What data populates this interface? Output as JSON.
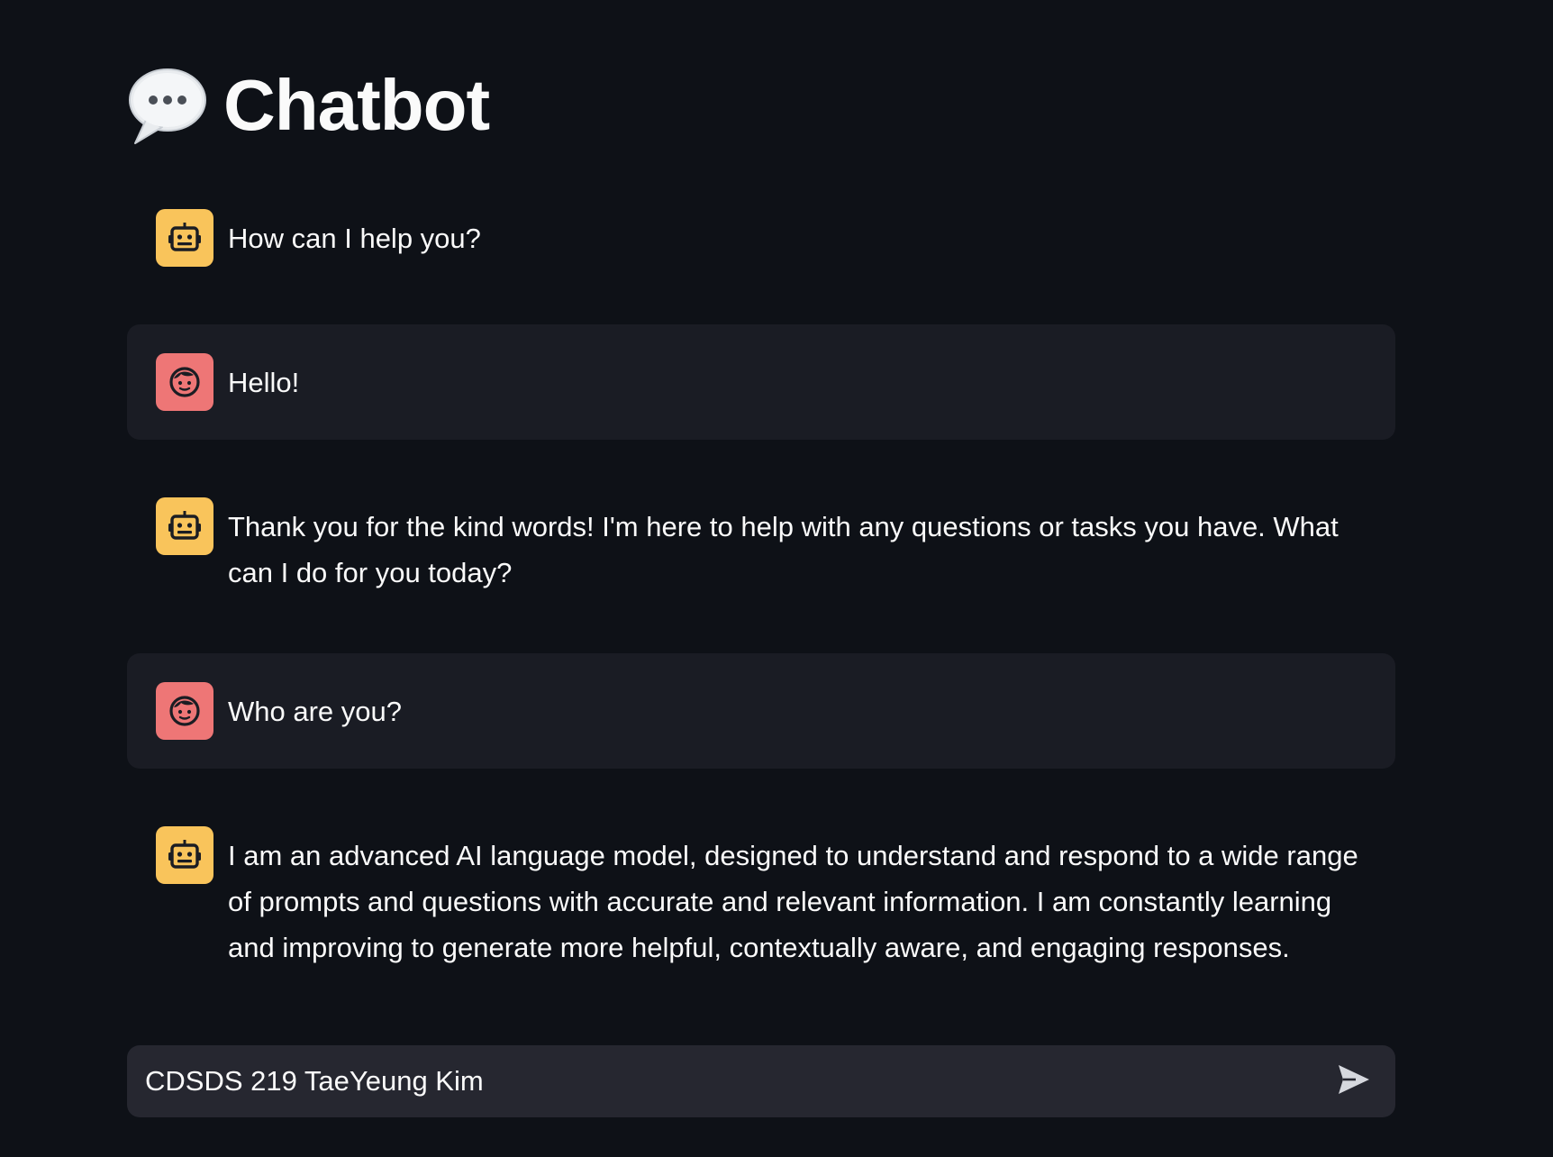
{
  "app": {
    "title": "Chatbot",
    "title_icon": "speech-bubble-icon"
  },
  "messages": [
    {
      "role": "assistant",
      "avatar": "robot-icon",
      "text": "How can I help you?"
    },
    {
      "role": "user",
      "avatar": "face-icon",
      "text": "Hello!"
    },
    {
      "role": "assistant",
      "avatar": "robot-icon",
      "text": "Thank you for the kind words! I'm here to help with any questions or tasks you have. What can I do for you today?"
    },
    {
      "role": "user",
      "avatar": "face-icon",
      "text": "Who are you?"
    },
    {
      "role": "assistant",
      "avatar": "robot-icon",
      "text": "I am an advanced AI language model, designed to understand and respond to a wide range of prompts and questions with accurate and relevant information. I am constantly learning and improving to generate more helpful, contextually aware, and engaging responses."
    }
  ],
  "chat_input": {
    "value": "CDSDS 219 TaeYeung Kim",
    "send_icon": "send-icon"
  },
  "colors": {
    "background": "#0e1117",
    "user_bubble": "#1a1c24",
    "input_bg": "#262730",
    "bot_avatar": "#f9c45b",
    "user_avatar": "#ee7676"
  }
}
